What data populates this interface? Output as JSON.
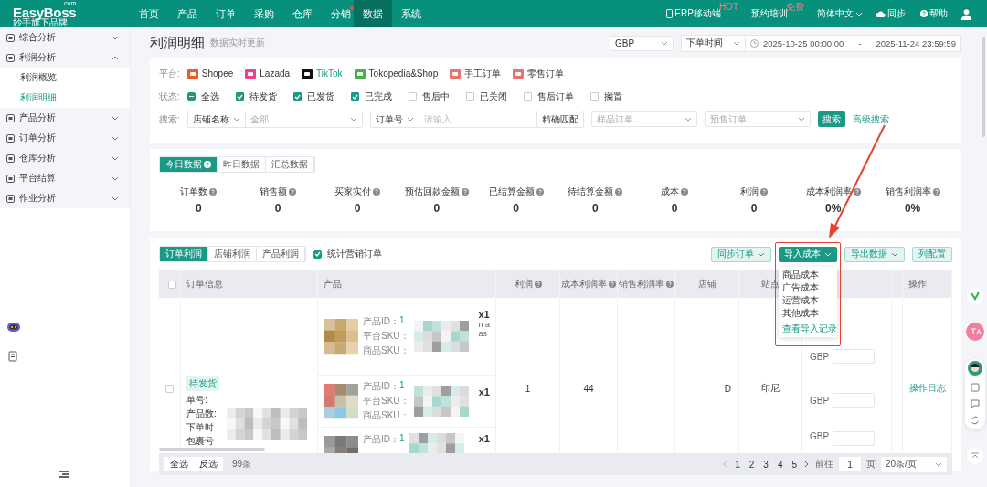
{
  "header": {
    "logo": "EasyBoss",
    "logo_domain": ".com",
    "tagline": "妙手旗下品牌",
    "menu": [
      {
        "label": "首页",
        "selected": false,
        "dot": false
      },
      {
        "label": "产品",
        "selected": false,
        "dot": false
      },
      {
        "label": "订单",
        "selected": false,
        "dot": false
      },
      {
        "label": "采购",
        "selected": false,
        "dot": false
      },
      {
        "label": "仓库",
        "selected": false,
        "dot": false
      },
      {
        "label": "分销",
        "selected": false,
        "dot": true
      },
      {
        "label": "数据",
        "selected": true,
        "dot": false
      },
      {
        "label": "系统",
        "selected": false,
        "dot": false
      }
    ],
    "links": [
      {
        "kind": "phone",
        "label": "ERP移动端",
        "badge": "HOT"
      },
      {
        "kind": "plain",
        "label": "预约培训",
        "badge": "免费"
      },
      {
        "kind": "lang",
        "label": "简体中文"
      },
      {
        "kind": "cloud",
        "label": "同步"
      },
      {
        "kind": "help",
        "label": "帮助"
      },
      {
        "kind": "user"
      }
    ]
  },
  "sidebar": {
    "items": [
      {
        "label": "综合分析",
        "expanded": false
      },
      {
        "label": "利润分析",
        "expanded": true,
        "children": [
          {
            "label": "利润概览",
            "selected": false
          },
          {
            "label": "利润明细",
            "selected": true
          }
        ]
      },
      {
        "label": "产品分析",
        "expanded": false
      },
      {
        "label": "订单分析",
        "expanded": false
      },
      {
        "label": "仓库分析",
        "expanded": false
      },
      {
        "label": "平台结算",
        "expanded": false
      },
      {
        "label": "作业分析",
        "expanded": false
      }
    ]
  },
  "page": {
    "title": "利润明细",
    "subtitle": "数据实时更新",
    "currency": "GBP",
    "time_type": "下单时间",
    "date_from": "2025-10-25 00:00:00",
    "date_sep": "-",
    "date_to": "2025-11-24 23:59:59"
  },
  "filters": {
    "platform_label": "平台:",
    "platforms": [
      {
        "label": "Shopee",
        "color": "#f15a24",
        "selected": false
      },
      {
        "label": "Lazada",
        "color": "#f0408a",
        "selected": false
      },
      {
        "label": "TikTok",
        "color": "#111111",
        "selected": true
      },
      {
        "label": "Tokopedia&Shop",
        "color": "#46b24c",
        "selected": false
      },
      {
        "label": "手工订单",
        "color": "#f07070",
        "selected": false
      },
      {
        "label": "零售订单",
        "color": "#f07070",
        "selected": false
      }
    ],
    "status_label": "状态:",
    "statuses": [
      {
        "label": "全选",
        "checked": true,
        "kind": "partial"
      },
      {
        "label": "待发货",
        "checked": true,
        "kind": "box"
      },
      {
        "label": "已发货",
        "checked": true,
        "kind": "box"
      },
      {
        "label": "已完成",
        "checked": true,
        "kind": "box"
      },
      {
        "label": "售后中",
        "checked": false,
        "kind": "box"
      },
      {
        "label": "已关闭",
        "checked": false,
        "kind": "box"
      },
      {
        "label": "售后订单",
        "checked": false,
        "kind": "box"
      },
      {
        "label": "搁置",
        "checked": false,
        "kind": "box"
      }
    ],
    "search_label": "搜索:",
    "shop_type": "店铺名称",
    "shop_value": "全部",
    "order_type": "订单号",
    "order_placeholder": "请输入",
    "match": "精确匹配",
    "sample_placeholder": "样品订单",
    "presale_placeholder": "预售订单",
    "search_button": "搜索",
    "advanced": "高级搜索"
  },
  "stats": {
    "tabs": [
      {
        "label": "今日数据",
        "selected": true
      },
      {
        "label": "昨日数据",
        "selected": false
      },
      {
        "label": "汇总数据",
        "selected": false
      }
    ],
    "items": [
      {
        "label": "订单数",
        "value": "0"
      },
      {
        "label": "销售额",
        "value": "0"
      },
      {
        "label": "买家实付",
        "value": "0"
      },
      {
        "label": "预估回款金额",
        "value": "0"
      },
      {
        "label": "已结算金额",
        "value": "0"
      },
      {
        "label": "待结算金额",
        "value": "0"
      },
      {
        "label": "成本",
        "value": "0"
      },
      {
        "label": "利润",
        "value": "0"
      },
      {
        "label": "成本利润率",
        "value": "0%"
      },
      {
        "label": "销售利润率",
        "value": "0%"
      }
    ]
  },
  "table": {
    "tabs": [
      {
        "label": "订单利润",
        "selected": true
      },
      {
        "label": "店铺利润",
        "selected": false
      },
      {
        "label": "产品利润",
        "selected": false
      }
    ],
    "marketing": {
      "label": "统计营销订单",
      "checked": true
    },
    "actions": [
      {
        "label": "同步订单",
        "kind": "outline"
      },
      {
        "label": "导入成本",
        "kind": "solid"
      },
      {
        "label": "导出数据",
        "kind": "outline"
      },
      {
        "label": "列配置",
        "kind": "plain"
      }
    ],
    "import_menu": [
      {
        "label": "商品成本",
        "kind": "item"
      },
      {
        "label": "广告成本",
        "kind": "item"
      },
      {
        "label": "运营成本",
        "kind": "item"
      },
      {
        "label": "其他成本",
        "kind": "item"
      },
      {
        "label": "查看导入记录",
        "kind": "link"
      }
    ],
    "select_all_checked": false,
    "columns": [
      {
        "label": "订单信息",
        "help": false
      },
      {
        "label": "产品",
        "help": false
      },
      {
        "label": "利润",
        "help": true
      },
      {
        "label": "成本利润率",
        "help": true
      },
      {
        "label": "销售利润率",
        "help": true
      },
      {
        "label": "店铺",
        "help": false
      },
      {
        "label": "站点",
        "help": false
      },
      {
        "label": "操作",
        "help": false
      }
    ],
    "row": {
      "checked": false,
      "status": "待发货",
      "fields": [
        "单号:",
        "产品数:",
        "下单时",
        "包裹号"
      ],
      "profit": "1",
      "cost_rate": "44",
      "shop": "D",
      "site": "印尼",
      "log": "操作日志",
      "products": [
        {
          "id_label": "产品ID：",
          "id_value": "1",
          "sku_label": "平台SKU：",
          "goods_label": "商品SKU：",
          "qty": "x1",
          "extra": [
            "n a",
            "as"
          ],
          "currency": "GBP"
        },
        {
          "id_label": "产品ID：",
          "id_value": "1",
          "sku_label": "平台SKU：",
          "goods_label": "商品SKU：",
          "qty": "x1",
          "currency": "GBP"
        },
        {
          "id_label": "产品ID：",
          "id_value": "1",
          "qty": "x1",
          "currency": "GBP"
        }
      ]
    },
    "footer": {
      "select_all": "全选",
      "invert": "反选",
      "count": "99条"
    },
    "pagination": {
      "pages": [
        {
          "label": "1",
          "selected": true
        },
        {
          "label": "2",
          "selected": false
        },
        {
          "label": "3",
          "selected": false
        },
        {
          "label": "4",
          "selected": false
        },
        {
          "label": "5",
          "selected": false
        }
      ],
      "goto": "前往",
      "page_value": "1",
      "page_unit": "页",
      "page_size": "20条/页"
    }
  }
}
